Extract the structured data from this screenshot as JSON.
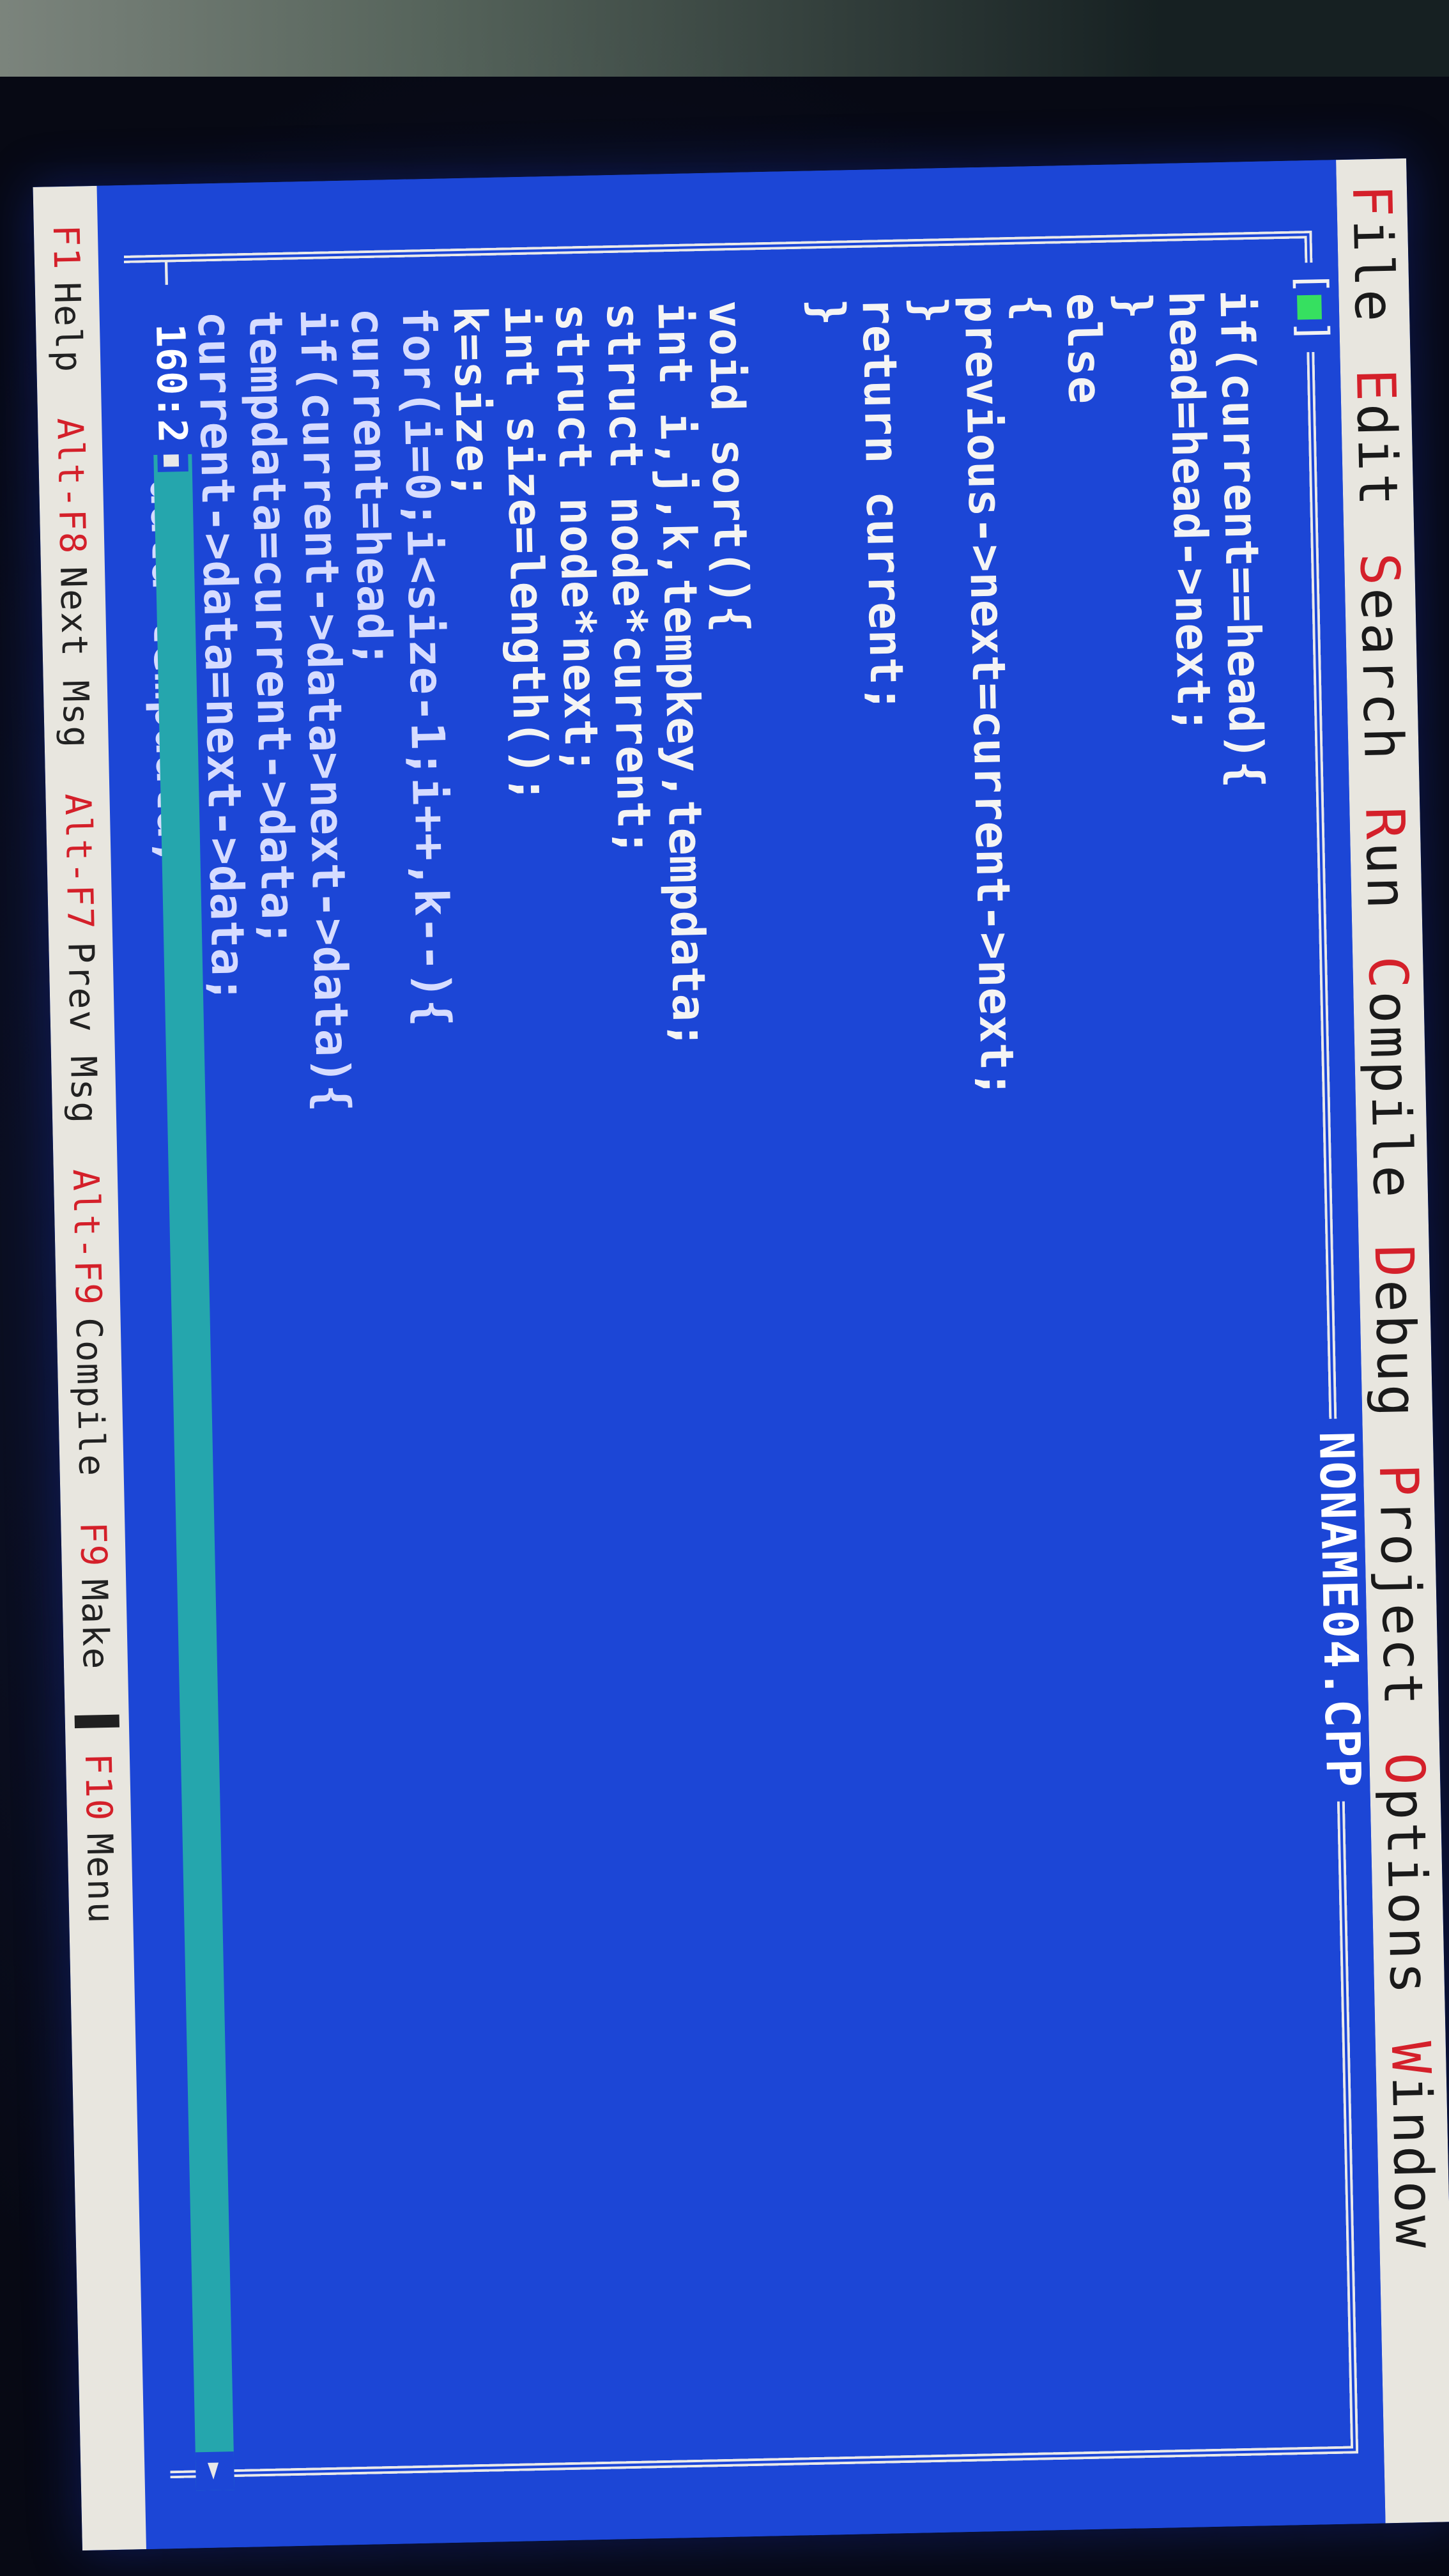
{
  "menu": {
    "items": [
      {
        "hotkey": "F",
        "rest": "ile"
      },
      {
        "hotkey": "E",
        "rest": "dit"
      },
      {
        "hotkey": "S",
        "rest": "earch"
      },
      {
        "hotkey": "R",
        "rest": "un"
      },
      {
        "hotkey": "C",
        "rest": "ompile"
      },
      {
        "hotkey": "D",
        "rest": "ebug"
      },
      {
        "hotkey": "P",
        "rest": "roject"
      },
      {
        "hotkey": "O",
        "rest": "ptions"
      },
      {
        "hotkey": "W",
        "rest": "indow"
      }
    ]
  },
  "window": {
    "close_box_left": "[",
    "close_box_mark": "■",
    "close_box_right": "]",
    "title": "NONAME04.CPP"
  },
  "code_lines": [
    "if(current==head){",
    "head=head->next;",
    "}",
    "else",
    "{",
    "previous->next=current->next;",
    "}",
    "return current;",
    "}",
    "",
    "void sort(){",
    "int i,j,k,tempkey,tempdata;",
    "struct node*current;",
    "struct node*next;",
    "int size=length();",
    "k=size;",
    "for(i=0;i<size-1;i++,k--){",
    "current=head;",
    "if(current->data>next->data){",
    "tempdata=current->data;",
    "current->data=next->data;",
    "next->data=tempdata;"
  ],
  "editor": {
    "cursor_position": "160:2",
    "dash": "—"
  },
  "statusbar": {
    "items": [
      {
        "key": "F1",
        "label": "Help"
      },
      {
        "key": "Alt-F8",
        "label": "Next Msg"
      },
      {
        "key": "Alt-F7",
        "label": "Prev Msg"
      },
      {
        "key": "Alt-F9",
        "label": "Compile"
      },
      {
        "key": "F9",
        "label": "Make"
      },
      {
        "key": "F10",
        "label": "Menu"
      }
    ]
  },
  "colors": {
    "editor_bg": "#1c46d6",
    "menu_bg": "#e8e6df",
    "hotkey": "#d4202a",
    "scrollbar": "#25a6ad"
  }
}
